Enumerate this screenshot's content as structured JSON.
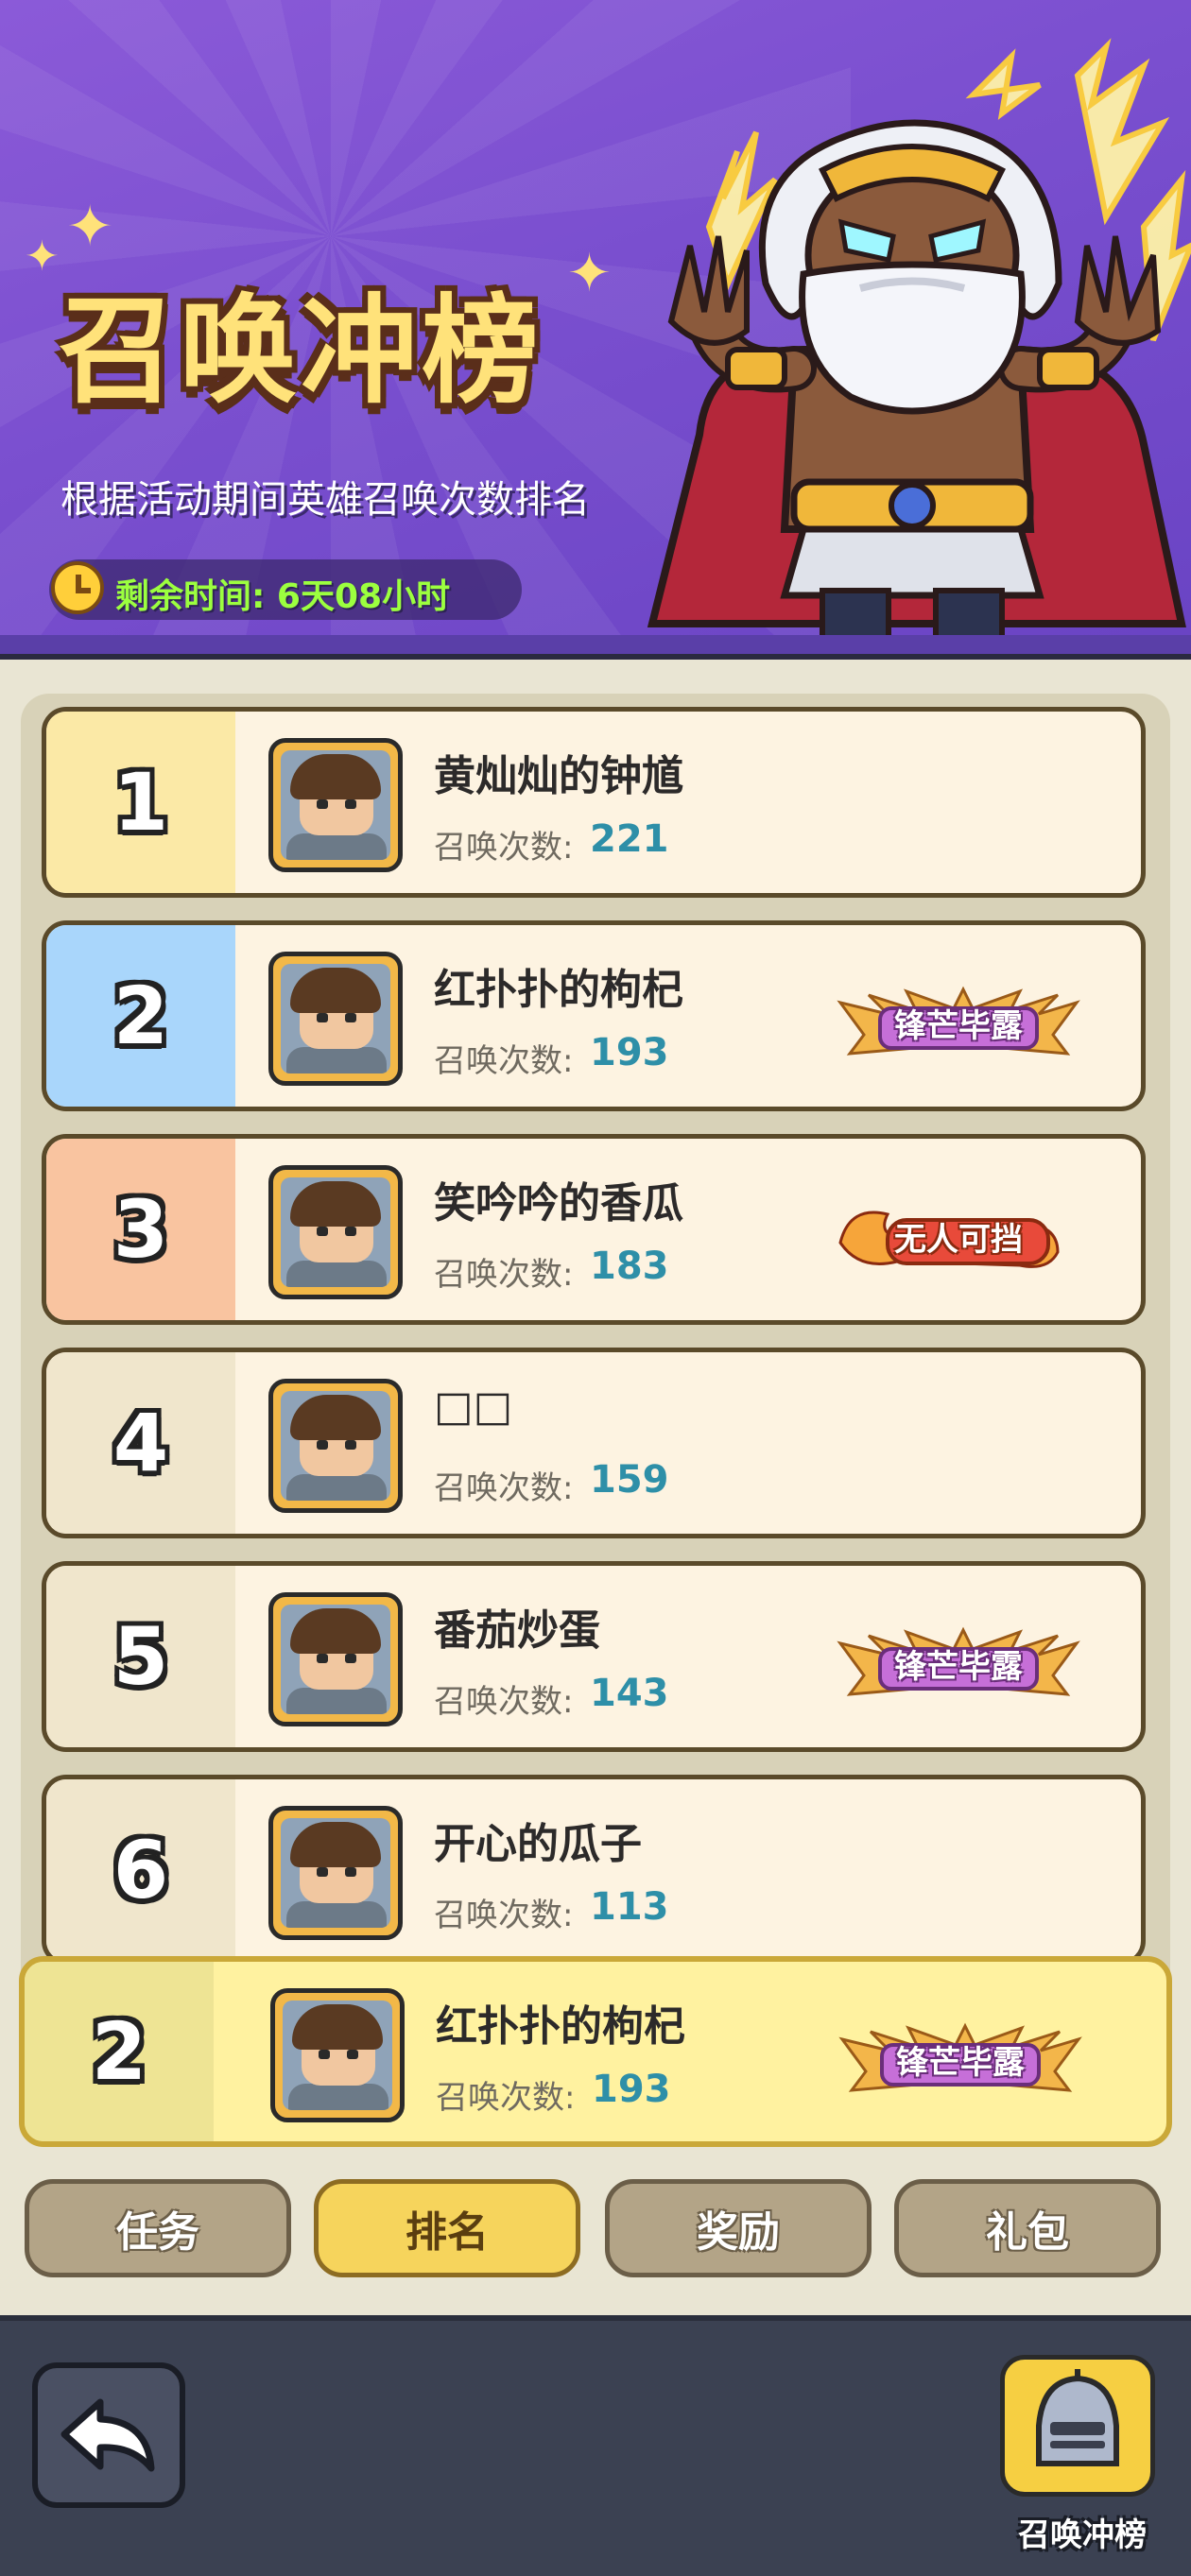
{
  "banner": {
    "title": "召唤冲榜",
    "subtitle": "根据活动期间英雄召唤次数排名",
    "timer_label": "剩余时间: 6天08小时"
  },
  "stat_label": "召唤次数:",
  "rows": [
    {
      "rank": "1",
      "name": "黄灿灿的钟馗",
      "count": "221",
      "badge": ""
    },
    {
      "rank": "2",
      "name": "红扑扑的枸杞",
      "count": "193",
      "badge": "锋芒毕露"
    },
    {
      "rank": "3",
      "name": "笑吟吟的香瓜",
      "count": "183",
      "badge": "无人可挡"
    },
    {
      "rank": "4",
      "name": "□□",
      "count": "159",
      "badge": ""
    },
    {
      "rank": "5",
      "name": "番茄炒蛋",
      "count": "143",
      "badge": "锋芒毕露"
    },
    {
      "rank": "6",
      "name": "开心的瓜子",
      "count": "113",
      "badge": ""
    }
  ],
  "self_row": {
    "rank": "2",
    "name": "红扑扑的枸杞",
    "count": "193",
    "badge": "锋芒毕露"
  },
  "tabs": [
    {
      "label": "任务",
      "active": false
    },
    {
      "label": "排名",
      "active": true
    },
    {
      "label": "奖励",
      "active": false
    },
    {
      "label": "礼包",
      "active": false
    }
  ],
  "footer": {
    "back_icon": "back-arrow-icon",
    "event_button_label": "召唤冲榜"
  },
  "colors": {
    "banner_purple": "#7a4fcf",
    "rank1": "#fbe9a6",
    "rank2": "#a9d6fb",
    "rank3": "#f9c4a0",
    "count_teal": "#2e8fa8",
    "active_tab": "#f6d45c"
  }
}
